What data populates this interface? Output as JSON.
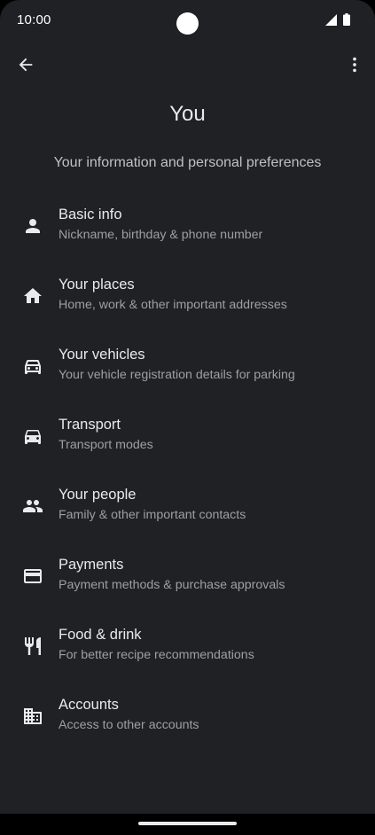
{
  "status_bar": {
    "time": "10:00",
    "icons": [
      "signal-icon",
      "battery-icon"
    ]
  },
  "top_bar": {
    "back_icon": "arrow-back-icon",
    "more_icon": "more-vert-icon"
  },
  "page": {
    "title": "You",
    "subtitle": "Your information and personal preferences"
  },
  "menu": {
    "items": [
      {
        "icon": "person-icon",
        "label": "Basic info",
        "description": "Nickname, birthday & phone number"
      },
      {
        "icon": "home-icon",
        "label": "Your places",
        "description": "Home, work & other important addresses"
      },
      {
        "icon": "car-outline-icon",
        "label": "Your vehicles",
        "description": "Your vehicle registration details for parking"
      },
      {
        "icon": "car-icon",
        "label": "Transport",
        "description": "Transport modes"
      },
      {
        "icon": "people-icon",
        "label": "Your people",
        "description": "Family & other important contacts"
      },
      {
        "icon": "credit-card-icon",
        "label": "Payments",
        "description": "Payment methods & purchase approvals"
      },
      {
        "icon": "restaurant-icon",
        "label": "Food & drink",
        "description": "For better recipe recommendations"
      },
      {
        "icon": "domain-icon",
        "label": "Accounts",
        "description": "Access to other accounts"
      }
    ]
  },
  "colors": {
    "background": "#202124",
    "primary_text": "#e8eaed",
    "secondary_text": "#9aa0a6"
  }
}
